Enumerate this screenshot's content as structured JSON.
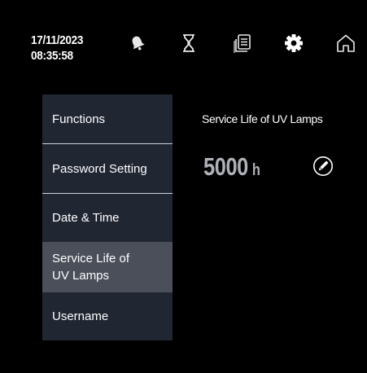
{
  "header": {
    "date": "17/11/2023",
    "time": "08:35:58",
    "icons": [
      "bell-icon",
      "hourglass-icon",
      "documents-icon",
      "gear-icon",
      "home-icon"
    ]
  },
  "menu": {
    "items": [
      {
        "label": "Functions"
      },
      {
        "label": "Password Setting"
      },
      {
        "label": "Date & Time"
      },
      {
        "label": "Service Life of UV Lamps",
        "active": true
      },
      {
        "label": "Username"
      }
    ]
  },
  "content": {
    "title": "Service Life of UV Lamps",
    "value": "5000",
    "unit": "h",
    "edit_icon": "pencil-icon"
  },
  "colors": {
    "background": "#000000",
    "menu_background": "#212633",
    "menu_active": "#4a4f5a",
    "value_text": "#aeb1b8"
  }
}
